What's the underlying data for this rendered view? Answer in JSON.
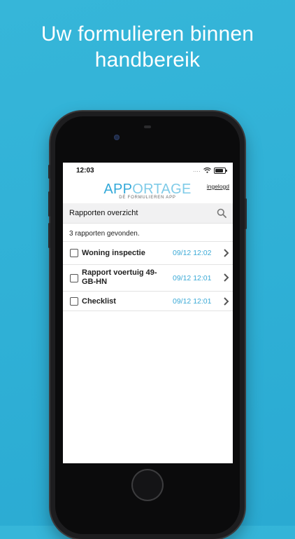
{
  "headline": {
    "line1": "Uw formulieren binnen",
    "line2": "handbereik"
  },
  "status_bar": {
    "time": "12:03",
    "signal": "....",
    "wifi_icon": "wifi-icon",
    "battery_icon": "battery-icon"
  },
  "app": {
    "logo_part1": "APP",
    "logo_part2": "ORTAGE",
    "logo_tagline": "DÉ FORMULIEREN APP",
    "login_link": "ingelogd",
    "brand_color": "#33a9d9"
  },
  "search": {
    "title": "Rapporten overzicht",
    "icon": "search-icon"
  },
  "results": {
    "count_text": "3 rapporten gevonden.",
    "items": [
      {
        "title": "Woning inspectie",
        "date": "09/12 12:02"
      },
      {
        "title": "Rapport voertuig 49-GB-HN",
        "date": "09/12 12:01"
      },
      {
        "title": "Checklist",
        "date": "09/12 12:01"
      }
    ]
  }
}
